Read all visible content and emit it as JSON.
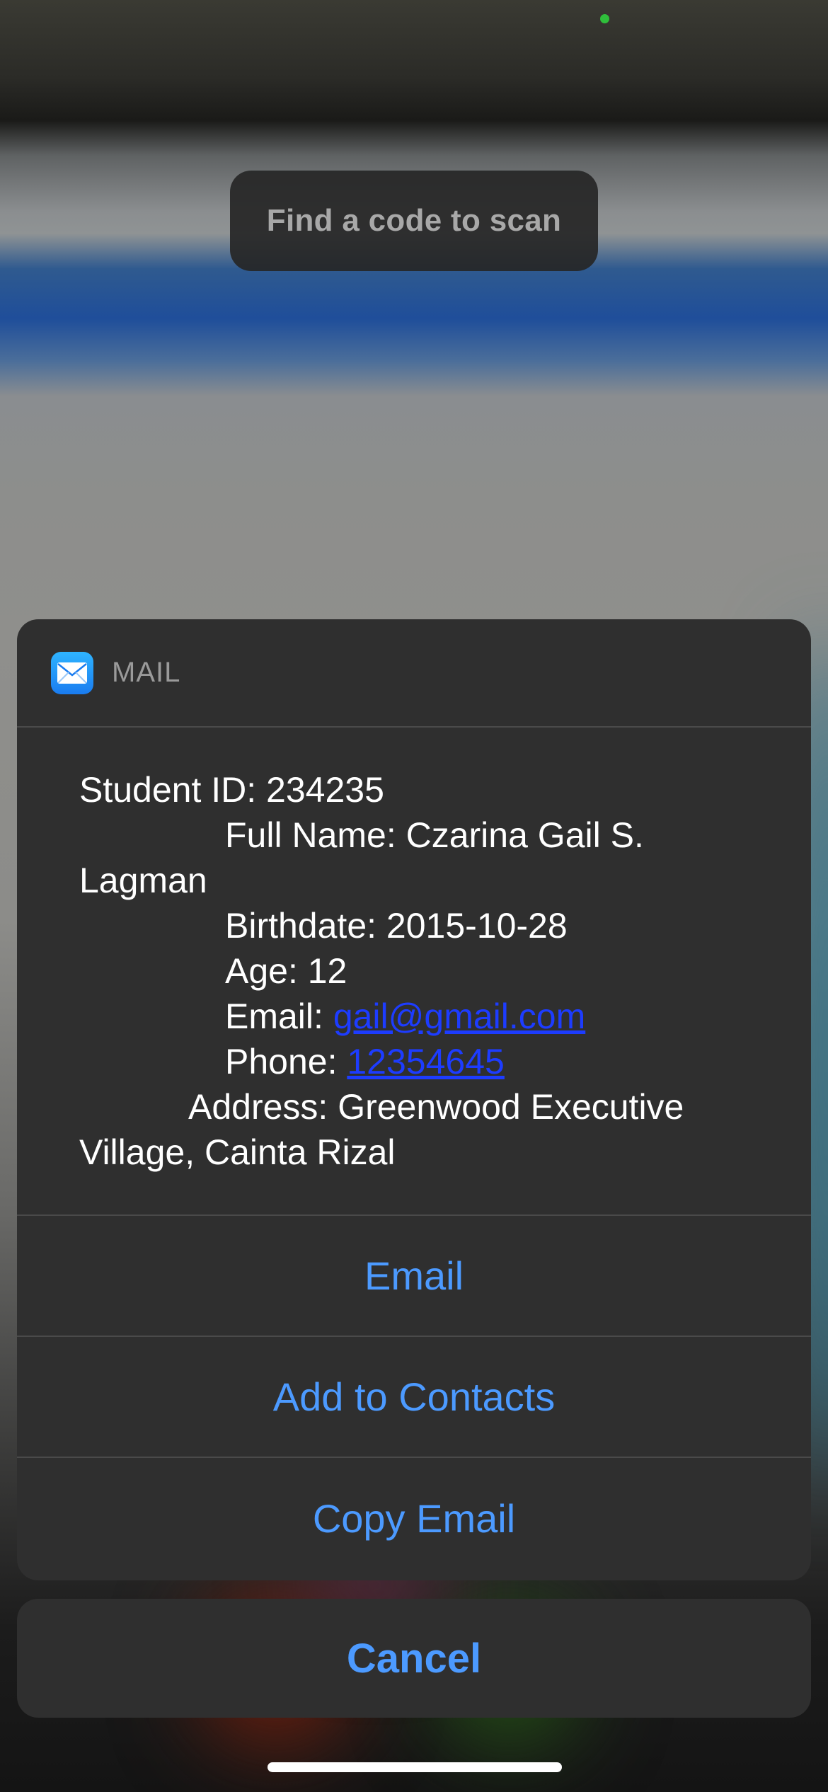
{
  "scanner": {
    "hint": "Find a code to scan"
  },
  "sheet": {
    "app_name": "MAIL",
    "contact_lines": {
      "student_id": "Student ID: 234235",
      "full_name_a": "Full Name: Czarina Gail S.",
      "full_name_b": "Lagman",
      "birthdate": "Birthdate: 2015-10-28",
      "age": "Age: 12",
      "email_label": "Email: ",
      "email_value": "gail@gmail.com",
      "phone_label": "Phone: ",
      "phone_value": "12354645",
      "address_a": "Address: Greenwood Executive",
      "address_b": "Village, Cainta Rizal"
    },
    "actions": {
      "email": "Email",
      "add_contact": "Add to Contacts",
      "copy_email": "Copy Email"
    },
    "cancel": "Cancel"
  },
  "colors": {
    "accent": "#4c9aff",
    "link": "#1d3cff",
    "sheet_bg": "#2f2f2f",
    "camera_indicator": "#2fbf3b"
  },
  "icons": {
    "app_icon": "mail-envelope-icon"
  }
}
